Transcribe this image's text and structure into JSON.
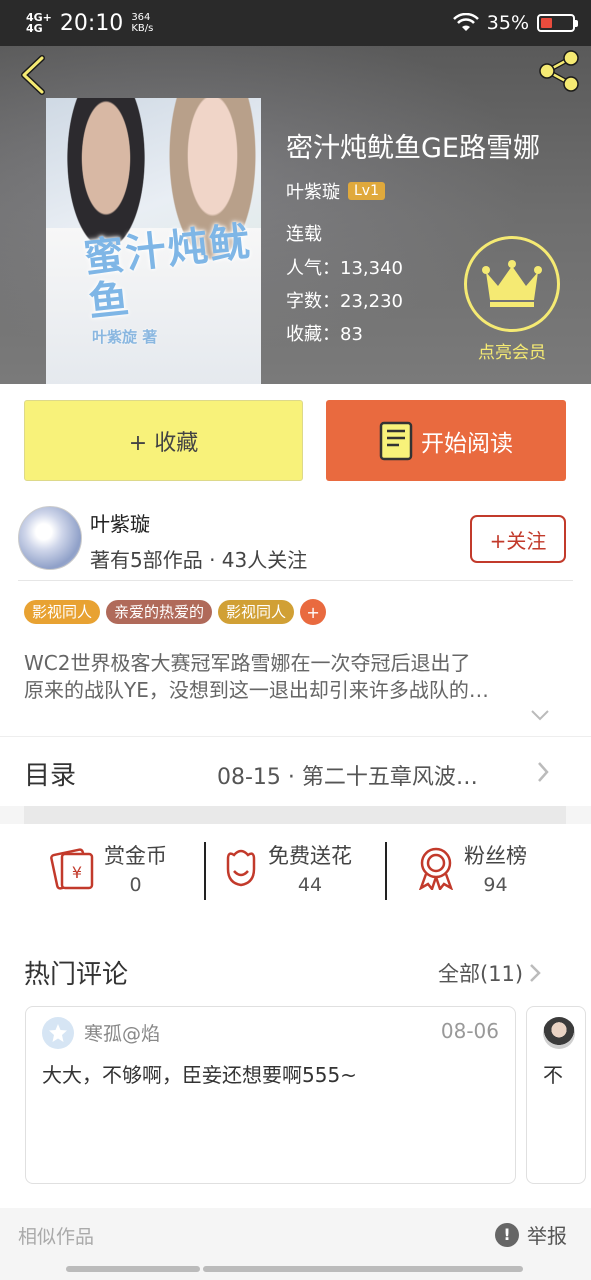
{
  "status_bar": {
    "network": "4G+",
    "network_sub": "4G",
    "time": "20:10",
    "speed_value": "364",
    "speed_unit": "KB/s",
    "battery": "35%",
    "battery_level": 0.35,
    "icons": [
      "signal-icon",
      "wifi-icon",
      "battery-icon"
    ]
  },
  "header": {
    "back_icon": "chevron-left-icon",
    "share_icon": "share-icon",
    "cover_title": "蜜汁炖鱿鱼",
    "cover_author": "叶紫旋 著",
    "title": "密汁炖鱿鱼GE路雪娜",
    "author": "叶紫璇",
    "level": "Lv1",
    "status": "连载",
    "popularity": "人气：13,340",
    "word_count": "字数：23,230",
    "favorites": "收藏：83",
    "vip_label": "点亮会员",
    "vip_icon": "crown-icon"
  },
  "actions": {
    "collect_label": "+ 收藏",
    "read_label": "开始阅读",
    "read_icon": "book-icon"
  },
  "author": {
    "name": "叶紫璇",
    "stats": "著有5部作品 · 43人关注",
    "follow_label": "+关注"
  },
  "tags": [
    {
      "label": "影视同人",
      "color": "#e8a232"
    },
    {
      "label": "亲爱的热爱的",
      "color": "#b06a5a"
    },
    {
      "label": "影视同人",
      "color": "#d1a035"
    }
  ],
  "tag_add": "+",
  "synopsis": {
    "line1": "WC2世界极客大赛冠军路雪娜在一次夺冠后退出了",
    "line2": "原来的战队YE，没想到这一退出却引来许多战队的…"
  },
  "catalog": {
    "label": "目录",
    "latest": "08-15 · 第二十五章风波…"
  },
  "stats": [
    {
      "label": "赏金币",
      "value": "0",
      "icon": "red-envelope-icon"
    },
    {
      "label": "免费送花",
      "value": "44",
      "icon": "flower-icon"
    },
    {
      "label": "粉丝榜",
      "value": "94",
      "icon": "medal-icon"
    }
  ],
  "comments": {
    "title": "热门评论",
    "all_label": "全部(11)",
    "items": [
      {
        "user": "寒孤@焰",
        "date": "08-06",
        "text": "大大，不够啊，臣妾还想要啊555~"
      },
      {
        "user": "",
        "date": "",
        "text": "不"
      }
    ]
  },
  "bottom": {
    "similar_label": "相似作品",
    "report_label": "举报",
    "report_icon": "!"
  },
  "colors": {
    "accent_orange": "#e96a3f",
    "collect_yellow": "#f8f27a",
    "follow_red": "#c23a2b",
    "vip_yellow": "#f5ea73"
  }
}
